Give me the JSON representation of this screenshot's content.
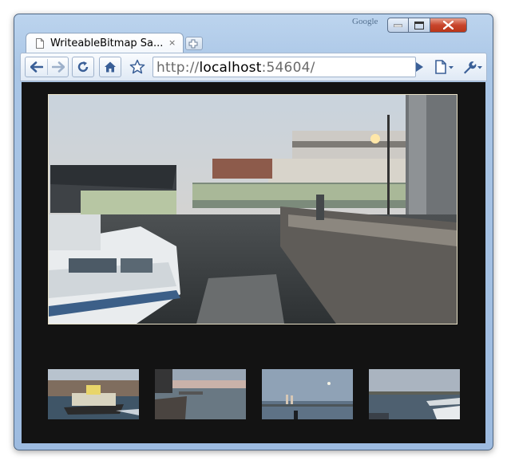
{
  "window": {
    "google_label": "Google",
    "controls": [
      "minimize",
      "maximize",
      "close"
    ]
  },
  "tab": {
    "title": "WriteableBitmap Sa...",
    "close_glyph": "×",
    "icon": "page-icon"
  },
  "toolbar": {
    "back_icon": "back-arrow-icon",
    "forward_icon": "forward-arrow-icon",
    "reload_icon": "reload-icon",
    "home_icon": "home-icon",
    "bookmark_icon": "star-icon",
    "go_icon": "play-icon",
    "page_menu_icon": "page-menu-icon",
    "tools_menu_icon": "wrench-icon"
  },
  "address": {
    "scheme": "http://",
    "host": "localhost",
    "rest": ":54604/"
  },
  "gallery": {
    "main_image": "harbor-ferry-dock-dusk",
    "thumbnails": [
      "ferry-boat-on-water",
      "pier-at-sunset",
      "person-by-harbor-moon",
      "harbor-with-boats"
    ]
  },
  "colors": {
    "content_background": "#131313",
    "photo_border": "#e9e2c8",
    "close_button": "#c8452c"
  }
}
